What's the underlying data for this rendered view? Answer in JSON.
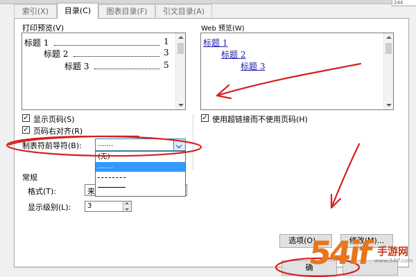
{
  "ruler_value": "244",
  "tabs": [
    {
      "label": "索引(X)",
      "active": false
    },
    {
      "label": "目录(C)",
      "active": true
    },
    {
      "label": "图表目录(F)",
      "active": false
    },
    {
      "label": "引文目录(A)",
      "active": false
    }
  ],
  "print_preview": {
    "label": "打印预览(V)",
    "entries": [
      {
        "text": "标题 1",
        "page": "1"
      },
      {
        "text": "标题 2",
        "page": "3"
      },
      {
        "text": "标题 3",
        "page": "5"
      }
    ]
  },
  "web_preview": {
    "label": "Web 预览(W)",
    "entries": [
      "标题 1",
      "标题 2",
      "标题 3"
    ]
  },
  "checkboxes": {
    "show_page_numbers": {
      "label": "显示页码(S)",
      "checked": true
    },
    "right_align": {
      "label": "页码右对齐(R)",
      "checked": true
    },
    "use_hyperlinks": {
      "label": "使用超链接而不使用页码(H)",
      "checked": true
    }
  },
  "tab_leader": {
    "label": "制表符前导符(B):",
    "value": ".......",
    "options": [
      "(无)",
      ".......",
      "-------",
      "_______"
    ]
  },
  "general": {
    "section_label": "常规",
    "format_label": "格式(T):",
    "format_value": "来 . . . . . . .",
    "levels_label": "显示级别(L):",
    "levels_value": "3"
  },
  "buttons": {
    "options": "选项(O)...",
    "modify": "修改(M)...",
    "ok": "确"
  },
  "annotation_color": "#d42020",
  "watermark": {
    "main": "54if",
    "side": "手游网",
    "url": "www.54if.com"
  }
}
